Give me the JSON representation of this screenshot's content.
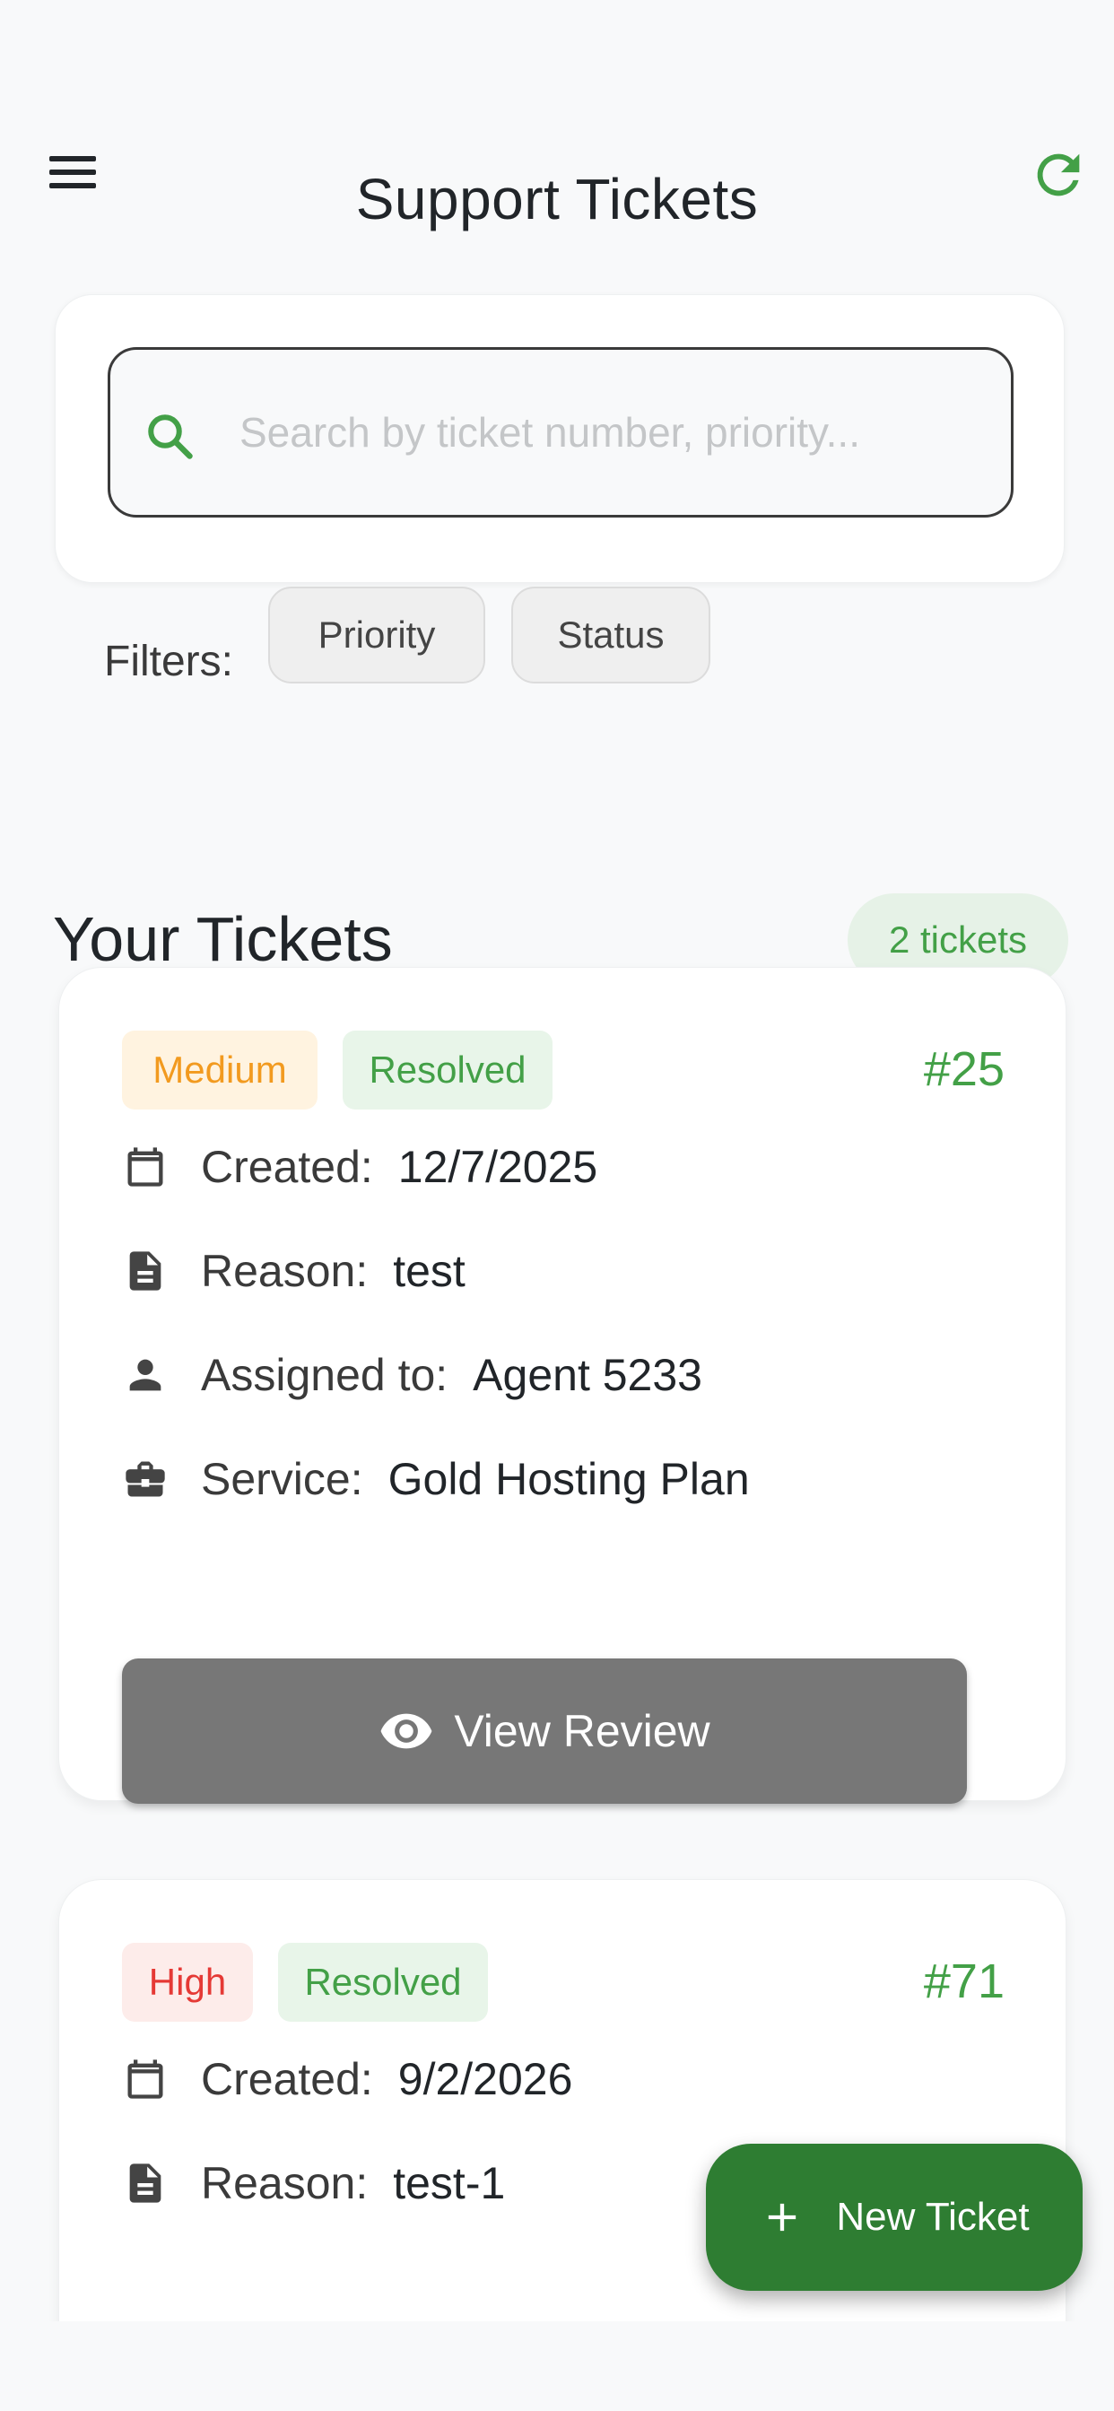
{
  "header": {
    "title": "Support Tickets",
    "menu_icon": "menu-icon",
    "refresh_icon": "refresh-icon"
  },
  "search": {
    "value": "",
    "placeholder": "Search by ticket number, priority..."
  },
  "filters": {
    "label": "Filters:",
    "options": [
      {
        "label": "Priority"
      },
      {
        "label": "Status"
      }
    ]
  },
  "tickets_section": {
    "title": "Your Tickets",
    "count": "2 tickets"
  },
  "labels": {
    "created": "Created:",
    "reason": "Reason:",
    "assigned": "Assigned to:",
    "service": "Service:"
  },
  "tickets": [
    {
      "priority": "Medium",
      "status": "Resolved",
      "number": "#25",
      "created": "12/7/2025",
      "reason": "test",
      "assigned_to": "Agent 5233",
      "service": "Gold Hosting Plan",
      "action_label": "View Review"
    },
    {
      "priority": "High",
      "status": "Resolved",
      "number": "#71",
      "created": "9/2/2026",
      "reason": "test-1"
    }
  ],
  "fab": {
    "label": "New Ticket"
  },
  "colors": {
    "accent": "#43a047",
    "fab": "#2e7d32",
    "medium": "#f29a1f",
    "high": "#e53935",
    "view_button": "#777777"
  }
}
